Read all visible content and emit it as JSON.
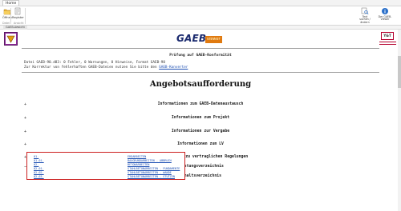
{
  "ribbon": {
    "tab_label": "Home",
    "open_label": "Öffnen",
    "register_label": "Register",
    "group_file_label": "Datei",
    "group_view_label": "Ansicht",
    "search_label": "Text suchen / ändern",
    "viewer_label": "Der GAEB-Viewer"
  },
  "panel": {
    "title": "GAEB-Ansicht",
    "close_glyph": "✕"
  },
  "logos": {
    "gaeb_text": "GAEB",
    "viewer_text": "viewer",
    "vat_text": "Y&T"
  },
  "check": {
    "title": "Prüfung auf GAEB-Konformität",
    "line1": "Datei GAEB-90.d83: 0 Fehler, 0 Warnungen, 0 Hinweise, Format GAEB-90",
    "line2_prefix": "Zur Korrektur von fehlerhaften GAEB-Dateien nutzen Sie bitte den ",
    "line2_link": "GAEB-Konverter"
  },
  "doc_title": "Angebotsaufforderung",
  "sections": [
    {
      "toggle": "+",
      "label": "Informationen zum GAEB-Datenaustausch"
    },
    {
      "toggle": "+",
      "label": "Informationen zum Projekt"
    },
    {
      "toggle": "+",
      "label": "Informationen zur Vergabe"
    },
    {
      "toggle": "+",
      "label": "Informationen zum LV"
    },
    {
      "toggle": "+",
      "label": "Informationen zu vertraglichen Regelungen"
    },
    {
      "toggle": "−",
      "label": "Leistungsverzeichnis"
    }
  ],
  "subsection": {
    "toggle": "−",
    "label": "Inhaltsverzeichnis"
  },
  "toc": [
    {
      "num": "01.",
      "name": "ERDARBEITEN"
    },
    {
      "num": "01.01.",
      "name": "BAUGRUNDARBEITEN - ABBRUCH"
    },
    {
      "num": "02.",
      "name": "BETONARBEITEN"
    },
    {
      "num": "02.01.",
      "name": "STAHLBETONARBEITEN - FUNDAMENTE"
    },
    {
      "num": "02.02.",
      "name": "STAHLBETONARBEITEN - WÄNDE"
    },
    {
      "num": "02.03.",
      "name": "STAHLBETONARBEITEN - STÜTZEN"
    }
  ],
  "colors": {
    "accent_red": "#cc1f1f",
    "link_blue": "#1d4fb3",
    "logo_purple": "#8e2a9a",
    "logo_orange": "#e07a10"
  }
}
